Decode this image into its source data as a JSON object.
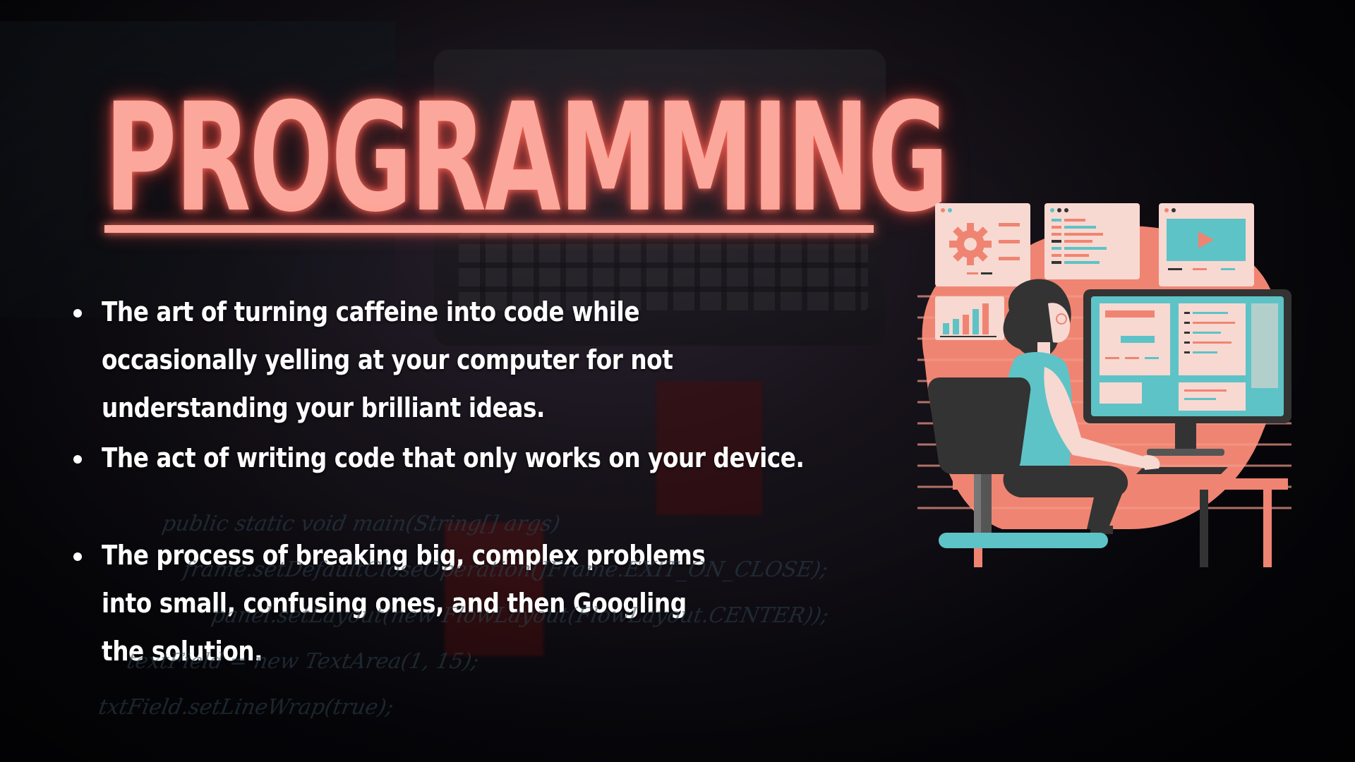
{
  "slide": {
    "title": "PROGRAMMING",
    "bullets": [
      {
        "text": "The art of turning caffeine into code while occasionally yelling at your computer for not understanding your brilliant ideas."
      },
      {
        "text": "The act of writing code that only works on your device."
      },
      {
        "text": "The process of breaking big, complex problems into small, confusing ones, and then Googling the solution."
      }
    ]
  },
  "colors": {
    "title": "#fca79b",
    "bullet_text": "#ffffff",
    "illustration_coral": "#f08472",
    "illustration_teal": "#5ec3c6",
    "illustration_panel": "#f7d9d2",
    "background": "#07070c"
  },
  "illustration": {
    "subject": "person-at-computer-illustration",
    "icons": [
      "gear-icon",
      "code-lines-icon",
      "play-video-icon",
      "bar-chart-icon",
      "monitor-icon",
      "desk-chair-icon"
    ]
  }
}
